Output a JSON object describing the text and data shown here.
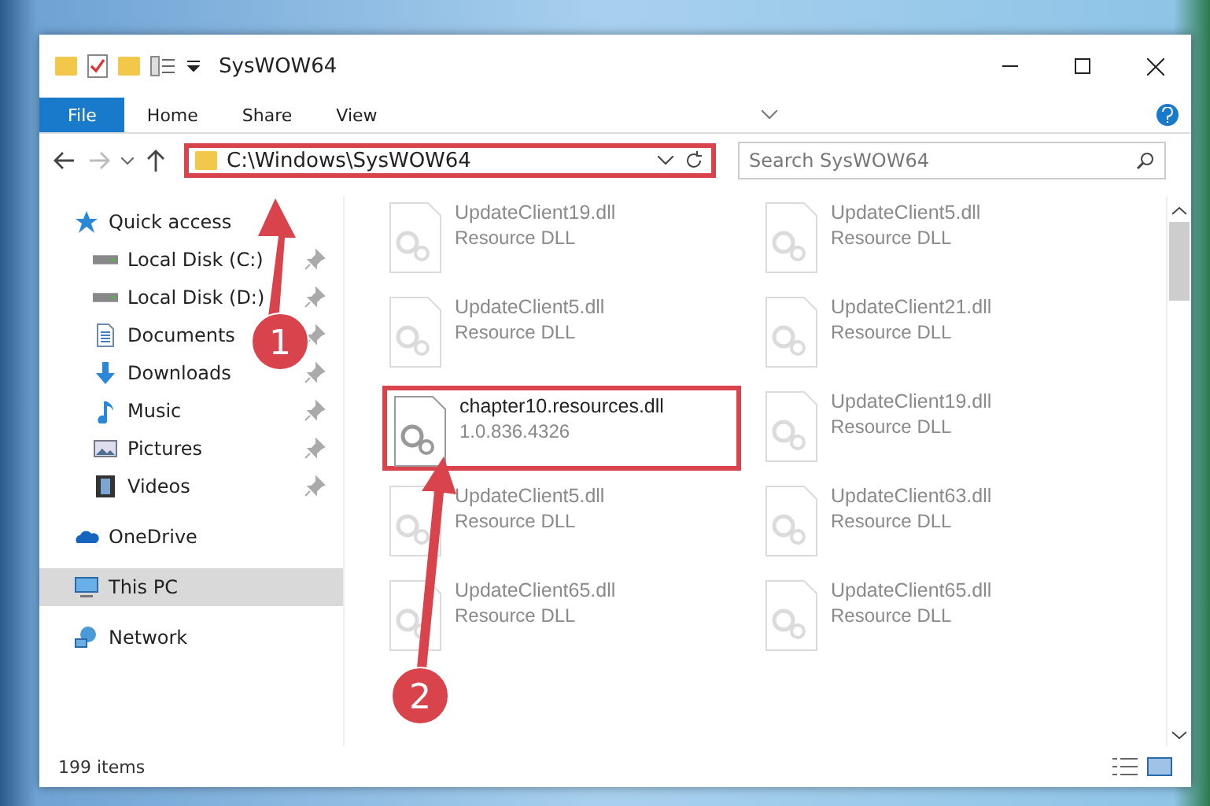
{
  "window": {
    "title": "SysWOW64"
  },
  "ribbon": {
    "tabs": [
      {
        "label": "File",
        "selected": true
      },
      {
        "label": "Home",
        "selected": false
      },
      {
        "label": "Share",
        "selected": false
      },
      {
        "label": "View",
        "selected": false
      }
    ]
  },
  "address_bar": {
    "path": "C:\\Windows\\SysWOW64",
    "highlighted": true
  },
  "search": {
    "placeholder": "Search SysWOW64"
  },
  "navigation": [
    {
      "label": "Quick access",
      "kind": "star",
      "selected": false,
      "children": [
        {
          "label": "Local Disk (C:)",
          "kind": "disk",
          "pinned": true,
          "selected": false
        },
        {
          "label": "Local Disk (D:)",
          "kind": "disk",
          "pinned": true,
          "selected": false
        },
        {
          "label": "Documents",
          "kind": "documents",
          "pinned": true,
          "selected": false
        },
        {
          "label": "Downloads",
          "kind": "downloads",
          "pinned": true,
          "selected": false
        },
        {
          "label": "Music",
          "kind": "music",
          "pinned": true,
          "selected": false
        },
        {
          "label": "Pictures",
          "kind": "pictures",
          "pinned": true,
          "selected": false
        },
        {
          "label": "Videos",
          "kind": "videos",
          "pinned": true,
          "selected": false
        }
      ]
    },
    {
      "label": "OneDrive",
      "kind": "cloud",
      "selected": false
    },
    {
      "label": "This PC",
      "kind": "pc",
      "selected": true
    },
    {
      "label": "Network",
      "kind": "network",
      "selected": false
    }
  ],
  "files": [
    {
      "name": "UpdateClient19.dll",
      "detail": "Resource DLL",
      "faded": true,
      "highlighted": false
    },
    {
      "name": "UpdateClient5.dll",
      "detail": "Resource DLL",
      "faded": true,
      "highlighted": false
    },
    {
      "name": "UpdateClient5.dll",
      "detail": "Resource DLL",
      "faded": true,
      "highlighted": false
    },
    {
      "name": "UpdateClient21.dll",
      "detail": "Resource DLL",
      "faded": true,
      "highlighted": false
    },
    {
      "name": "chapter10.resources.dll",
      "detail": "1.0.836.4326",
      "faded": false,
      "highlighted": true
    },
    {
      "name": "UpdateClient19.dll",
      "detail": "Resource DLL",
      "faded": true,
      "highlighted": false
    },
    {
      "name": "UpdateClient5.dll",
      "detail": "Resource DLL",
      "faded": true,
      "highlighted": false
    },
    {
      "name": "UpdateClient63.dll",
      "detail": "Resource DLL",
      "faded": true,
      "highlighted": false
    },
    {
      "name": "UpdateClient65.dll",
      "detail": "Resource DLL",
      "faded": true,
      "highlighted": false
    },
    {
      "name": "UpdateClient65.dll",
      "detail": "Resource DLL",
      "faded": true,
      "highlighted": false
    }
  ],
  "status_bar": {
    "item_count": "199 items"
  },
  "callouts": [
    {
      "number": "1"
    },
    {
      "number": "2"
    }
  ]
}
